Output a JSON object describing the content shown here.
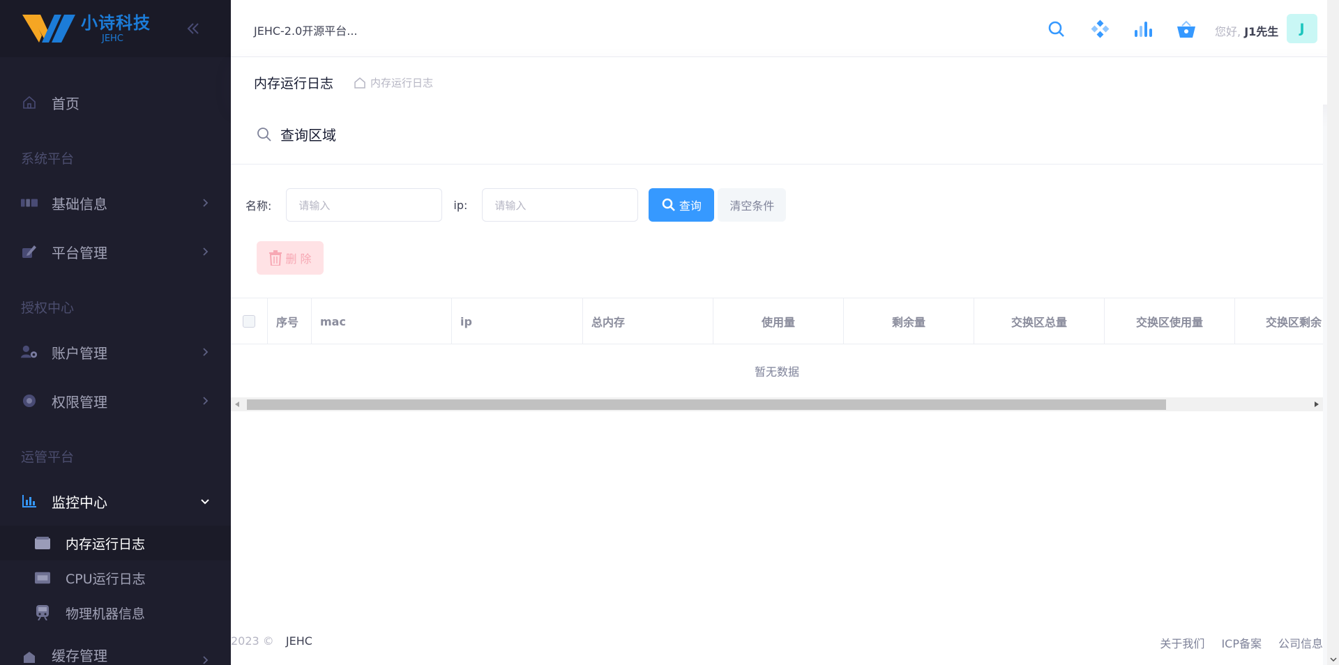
{
  "brand": {
    "name_cn": "小诗科技",
    "name_en": "JEHC"
  },
  "sidebar": {
    "home": "首页",
    "sections": {
      "system": "系统平台",
      "auth": "授权中心",
      "ops": "运管平台"
    },
    "items": {
      "basic_info": "基础信息",
      "platform_mgmt": "平台管理",
      "account_mgmt": "账户管理",
      "permission_mgmt": "权限管理",
      "monitor_center": "监控中心",
      "cache_mgmt": "缓存管理"
    },
    "submenu": {
      "memory_log": "内存运行日志",
      "cpu_log": "CPU运行日志",
      "machine_info": "物理机器信息"
    }
  },
  "header": {
    "title": "JEHC-2.0开源平台...",
    "greeting": "您好,",
    "username": "J1先生",
    "avatar_letter": "J"
  },
  "subheader": {
    "page_title": "内存运行日志",
    "breadcrumb": "内存运行日志"
  },
  "query": {
    "title": "查询区域",
    "name_label": "名称:",
    "name_placeholder": "请输入",
    "ip_label": "ip:",
    "ip_placeholder": "请输入",
    "search_btn": "查询",
    "clear_btn": "清空条件",
    "delete_btn": "删 除"
  },
  "table": {
    "columns": [
      "序号",
      "mac",
      "ip",
      "总内存",
      "使用量",
      "剩余量",
      "交换区总量",
      "交换区使用量",
      "交换区剩余"
    ],
    "empty_text": "暂无数据"
  },
  "footer": {
    "year": "2023 ©",
    "brand": "JEHC",
    "links": [
      "关于我们",
      "ICP备案",
      "公司信息"
    ]
  },
  "colors": {
    "sidebar_bg": "#1e1e2d",
    "primary": "#3699ff",
    "danger_light": "#ffe2e5"
  }
}
